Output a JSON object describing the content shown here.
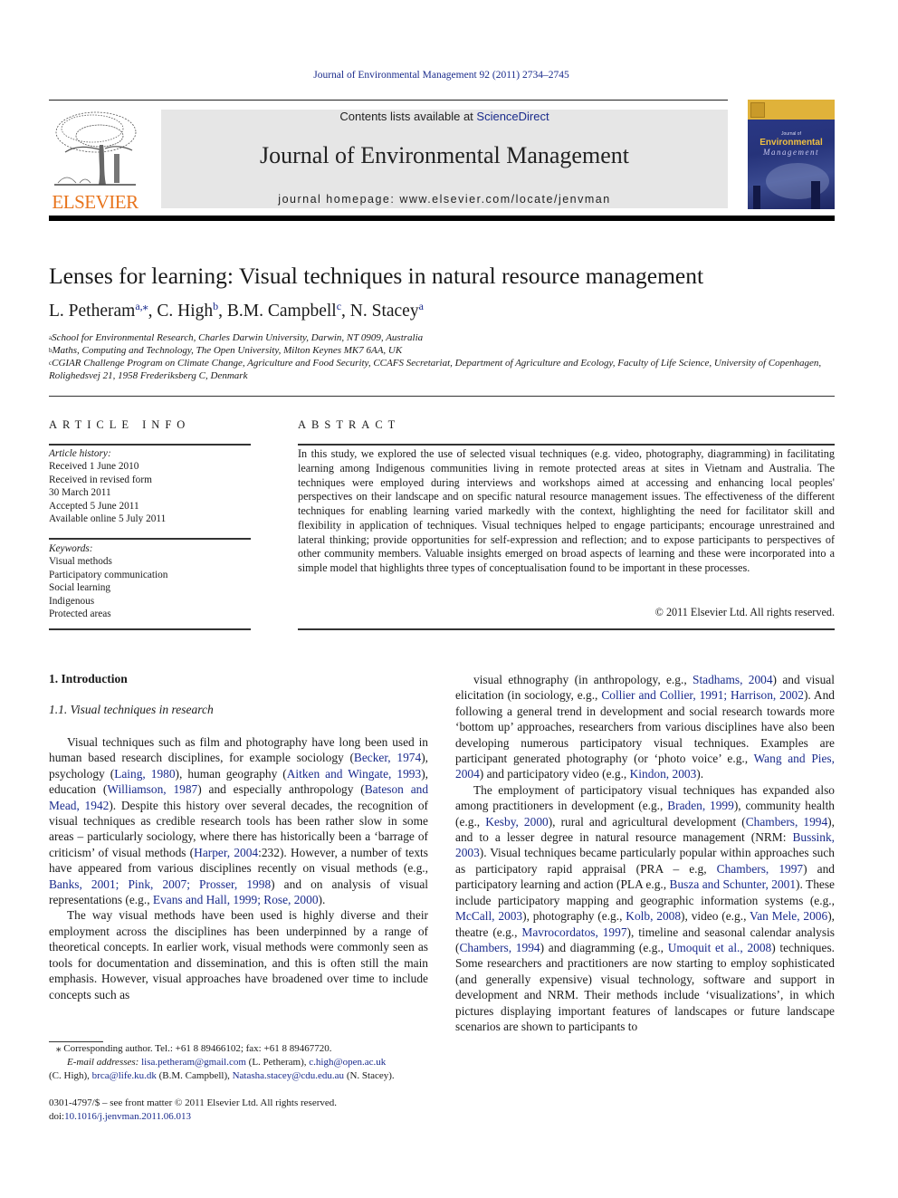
{
  "header": {
    "journal_ref": "Journal of Environmental Management 92 (2011) 2734–2745",
    "contents_prefix": "Contents lists available at ",
    "contents_link": "ScienceDirect",
    "journal_title": "Journal of Environmental Management",
    "homepage": "journal homepage: www.elsevier.com/locate/jenvman",
    "publisher_logo_text": "ELSEVIER",
    "cover": {
      "line1": "Journal of",
      "line2": "Environmental",
      "line3": "Management"
    },
    "colors": {
      "link": "#1a2b8c",
      "elsevier_orange": "#e8741c",
      "banner_bg": "#e6e6e6"
    }
  },
  "article": {
    "title": "Lenses for learning: Visual techniques in natural resource management",
    "authors": [
      {
        "name": "L. Petheram",
        "sup": "a,⁎"
      },
      {
        "name": "C. High",
        "sup": "b"
      },
      {
        "name": "B.M. Campbell",
        "sup": "c"
      },
      {
        "name": "N. Stacey",
        "sup": "a"
      }
    ],
    "affiliations": [
      {
        "sup": "a",
        "text": "School for Environmental Research, Charles Darwin University, Darwin, NT 0909, Australia"
      },
      {
        "sup": "b",
        "text": "Maths, Computing and Technology, The Open University, Milton Keynes MK7 6AA, UK"
      },
      {
        "sup": "c",
        "text": "CGIAR Challenge Program on Climate Change, Agriculture and Food Security, CCAFS Secretariat, Department of Agriculture and Ecology, Faculty of Life Science, University of Copenhagen, Rolighedsvej 21, 1958 Frederiksberg C, Denmark"
      }
    ]
  },
  "article_info": {
    "heading": "ARTICLE INFO",
    "history_label": "Article history:",
    "history": [
      "Received 1 June 2010",
      "Received in revised form",
      "30 March 2011",
      "Accepted 5 June 2011",
      "Available online 5 July 2011"
    ],
    "keywords_label": "Keywords:",
    "keywords": [
      "Visual methods",
      "Participatory communication",
      "Social learning",
      "Indigenous",
      "Protected areas"
    ]
  },
  "abstract": {
    "heading": "ABSTRACT",
    "text": "In this study, we explored the use of selected visual techniques (e.g. video, photography, diagramming) in facilitating learning among Indigenous communities living in remote protected areas at sites in Vietnam and Australia. The techniques were employed during interviews and workshops aimed at accessing and enhancing local peoples' perspectives on their landscape and on specific natural resource management issues. The effectiveness of the different techniques for enabling learning varied markedly with the context, highlighting the need for facilitator skill and flexibility in application of techniques. Visual techniques helped to engage participants; encourage unrestrained and lateral thinking; provide opportunities for self-expression and reflection; and to expose participants to perspectives of other community members. Valuable insights emerged on broad aspects of learning and these were incorporated into a simple model that highlights three types of conceptualisation found to be important in these processes.",
    "copyright": "© 2011 Elsevier Ltd. All rights reserved."
  },
  "body": {
    "section_heading": "1.  Introduction",
    "subsection_heading": "1.1.  Visual techniques in research",
    "col1_paragraphs": [
      [
        {
          "t": "Visual techniques such as film and photography have long been used in human based research disciplines, for example sociology ("
        },
        {
          "l": "Becker, 1974"
        },
        {
          "t": "), psychology ("
        },
        {
          "l": "Laing, 1980"
        },
        {
          "t": "), human geography ("
        },
        {
          "l": "Aitken and Wingate, 1993"
        },
        {
          "t": "), education ("
        },
        {
          "l": "Williamson, 1987"
        },
        {
          "t": ") and especially anthropology ("
        },
        {
          "l": "Bateson and Mead, 1942"
        },
        {
          "t": "). Despite this history over several decades, the recognition of visual techniques as credible research tools has been rather slow in some areas – particularly sociology, where there has historically been a ‘barrage of criticism’ of visual methods ("
        },
        {
          "l": "Harper, 2004"
        },
        {
          "t": ":232). However, a number of texts have appeared from various disciplines recently on visual methods (e.g., "
        },
        {
          "l": "Banks, 2001; Pink, 2007; Prosser, 1998"
        },
        {
          "t": ") and on analysis of visual representations (e.g., "
        },
        {
          "l": "Evans and Hall, 1999; Rose, 2000"
        },
        {
          "t": ")."
        }
      ],
      [
        {
          "t": "The way visual methods have been used is highly diverse and their employment across the disciplines has been underpinned by a range of theoretical concepts. In earlier work, visual methods were commonly seen as tools for documentation and dissemination, and this is often still the main emphasis. However, visual approaches have broadened over time to include concepts such as"
        }
      ]
    ],
    "col2_paragraphs": [
      [
        {
          "t": "visual ethnography (in anthropology, e.g., "
        },
        {
          "l": "Stadhams, 2004"
        },
        {
          "t": ") and visual elicitation (in sociology, e.g., "
        },
        {
          "l": "Collier and Collier, 1991; Harrison, 2002"
        },
        {
          "t": "). And following a general trend in development and social research towards more ‘bottom up’ approaches, researchers from various disciplines have also been developing numerous participatory visual techniques. Examples are participant generated photography (or ‘photo voice’ e.g., "
        },
        {
          "l": "Wang and Pies, 2004"
        },
        {
          "t": ") and participatory video (e.g., "
        },
        {
          "l": "Kindon, 2003"
        },
        {
          "t": ")."
        }
      ],
      [
        {
          "t": "The employment of participatory visual techniques has expanded also among practitioners in development (e.g., "
        },
        {
          "l": "Braden, 1999"
        },
        {
          "t": "), community health (e.g., "
        },
        {
          "l": "Kesby, 2000"
        },
        {
          "t": "), rural and agricultural development ("
        },
        {
          "l": "Chambers, 1994"
        },
        {
          "t": "), and to a lesser degree in natural resource management (NRM: "
        },
        {
          "l": "Bussink, 2003"
        },
        {
          "t": "). Visual techniques became particularly popular within approaches such as participatory rapid appraisal (PRA – e.g, "
        },
        {
          "l": "Chambers, 1997"
        },
        {
          "t": ") and participatory learning and action (PLA e.g., "
        },
        {
          "l": "Busza and Schunter, 2001"
        },
        {
          "t": "). These include participatory mapping and geographic information systems (e.g., "
        },
        {
          "l": "McCall, 2003"
        },
        {
          "t": "), photography (e.g., "
        },
        {
          "l": "Kolb, 2008"
        },
        {
          "t": "), video (e.g., "
        },
        {
          "l": "Van Mele, 2006"
        },
        {
          "t": "), theatre (e.g., "
        },
        {
          "l": "Mavrocordatos, 1997"
        },
        {
          "t": "), timeline and seasonal calendar analysis ("
        },
        {
          "l": "Chambers, 1994"
        },
        {
          "t": ") and diagramming (e.g., "
        },
        {
          "l": "Umoquit et al., 2008"
        },
        {
          "t": ") techniques. Some researchers and practitioners are now starting to employ sophisticated (and generally expensive) visual technology, software and support in development and NRM. Their methods include ‘visualizations’, in which pictures displaying important features of landscapes or future landscape scenarios are shown to participants to"
        }
      ]
    ]
  },
  "footnote": {
    "star_line": "⁎  Corresponding author. Tel.: +61 8 89466102; fax: +61 8 89467720.",
    "email_label": "E-mail addresses:",
    "emails": [
      {
        "email": "lisa.petheram@gmail.com",
        "who": "(L. Petheram)"
      },
      {
        "email": "c.high@open.ac.uk",
        "who": "(C. High)"
      },
      {
        "email": "brca@life.ku.dk",
        "who": "(B.M. Campbell)"
      },
      {
        "email": "Natasha.stacey@cdu.edu.au",
        "who": "(N. Stacey)."
      }
    ]
  },
  "bottom": {
    "issn_line": "0301-4797/$ – see front matter © 2011 Elsevier Ltd. All rights reserved.",
    "doi_prefix": "doi:",
    "doi": "10.1016/j.jenvman.2011.06.013"
  }
}
